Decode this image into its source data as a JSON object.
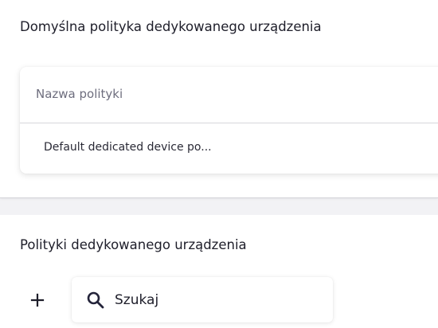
{
  "default_policy_section": {
    "title": "Domyślna polityka dedykowanego urządzenia",
    "table": {
      "column_header": "Nazwa polityki",
      "rows": [
        {
          "name": "Default dedicated device po..."
        }
      ]
    }
  },
  "policies_section": {
    "title": "Polityki dedykowanego urządzenia",
    "add_icon": "plus-icon",
    "search": {
      "icon": "search-icon",
      "placeholder": "Szukaj"
    }
  },
  "colors": {
    "text_primary": "#1e1e2a",
    "text_secondary": "#6e6e7e",
    "search_icon": "#24243a",
    "page_background": "#f2f2f5"
  }
}
